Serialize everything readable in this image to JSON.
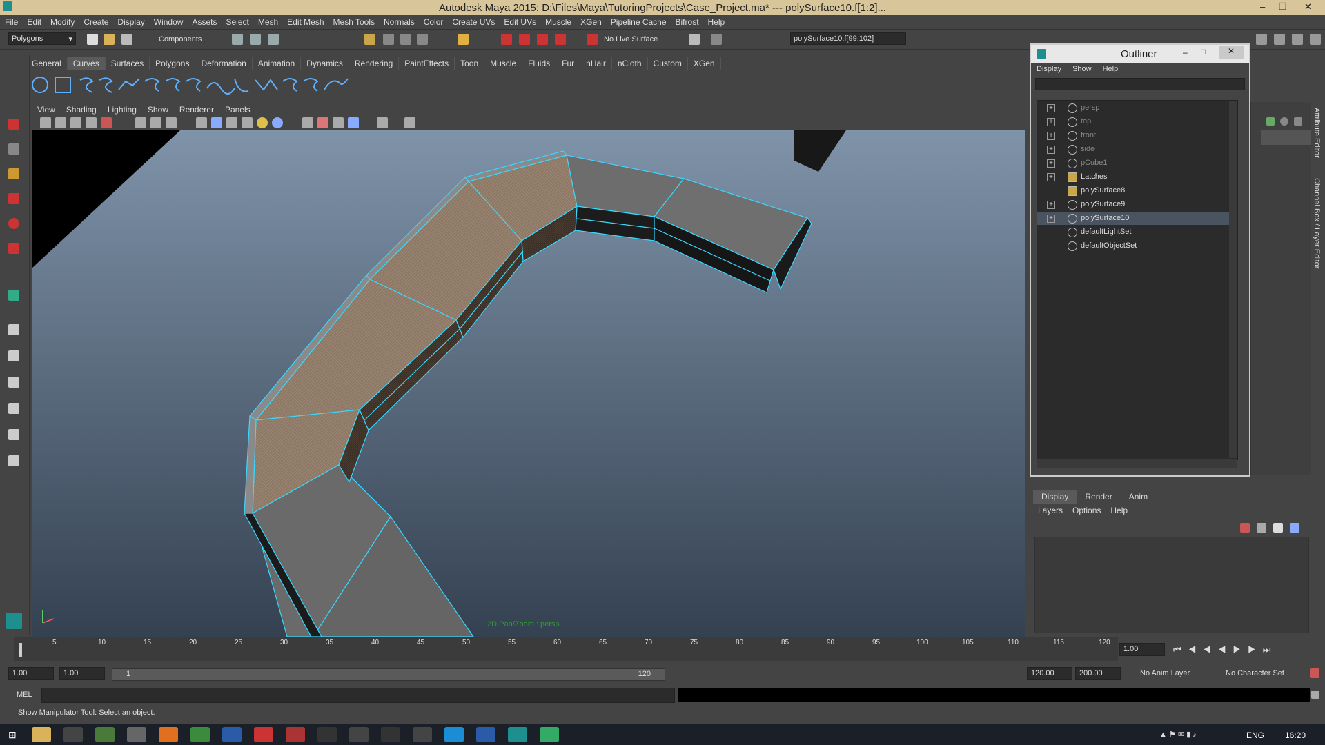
{
  "window": {
    "title": "Autodesk Maya 2015: D:\\Files\\Maya\\TutoringProjects\\Case_Project.ma*  ---  polySurface10.f[1:2]..."
  },
  "menubar": [
    "File",
    "Edit",
    "Modify",
    "Create",
    "Display",
    "Window",
    "Assets",
    "Select",
    "Mesh",
    "Edit Mesh",
    "Mesh Tools",
    "Normals",
    "Color",
    "Create UVs",
    "Edit UVs",
    "Muscle",
    "XGen",
    "Pipeline Cache",
    "Bifrost",
    "Help"
  ],
  "statusline": {
    "menu_set": "Polygons",
    "select_mode": "Components",
    "live_surface": "No Live Surface",
    "selection_field": "polySurface10.f[99:102]"
  },
  "shelf_tabs": [
    "General",
    "Curves",
    "Surfaces",
    "Polygons",
    "Deformation",
    "Animation",
    "Dynamics",
    "Rendering",
    "PaintEffects",
    "Toon",
    "Muscle",
    "Fluids",
    "Fur",
    "nHair",
    "nCloth",
    "Custom",
    "XGen"
  ],
  "shelf_active": "Curves",
  "viewport": {
    "menus": [
      "View",
      "Shading",
      "Lighting",
      "Show",
      "Renderer",
      "Panels"
    ],
    "hud": "2D Pan/Zoom : persp"
  },
  "outliner": {
    "title": "Outliner",
    "menus": [
      "Display",
      "Show",
      "Help"
    ],
    "items": [
      {
        "label": "persp",
        "dim": true,
        "expand": true
      },
      {
        "label": "top",
        "dim": true,
        "expand": true
      },
      {
        "label": "front",
        "dim": true,
        "expand": true
      },
      {
        "label": "side",
        "dim": true,
        "expand": true
      },
      {
        "label": "pCube1",
        "dim": true,
        "expand": true
      },
      {
        "label": "Latches",
        "dim": false,
        "expand": true
      },
      {
        "label": "polySurface8",
        "dim": false,
        "expand": false
      },
      {
        "label": "polySurface9",
        "dim": false,
        "expand": true
      },
      {
        "label": "polySurface10",
        "dim": false,
        "expand": true,
        "selected": true
      },
      {
        "label": "defaultLightSet",
        "dim": false,
        "expand": false
      },
      {
        "label": "defaultObjectSet",
        "dim": false,
        "expand": false
      }
    ]
  },
  "side_tabs": {
    "attr": "Attribute Editor",
    "channel": "Channel Box / Layer Editor"
  },
  "layer_editor": {
    "tabs": [
      "Display",
      "Render",
      "Anim"
    ],
    "menus": [
      "Layers",
      "Options",
      "Help"
    ]
  },
  "timeline": {
    "ticks": [
      "1",
      "5",
      "10",
      "15",
      "20",
      "25",
      "30",
      "35",
      "40",
      "45",
      "50",
      "55",
      "60",
      "65",
      "70",
      "75",
      "80",
      "85",
      "90",
      "95",
      "100",
      "105",
      "110",
      "115",
      "120"
    ],
    "current": "1.00"
  },
  "range": {
    "start": "1.00",
    "start2": "1.00",
    "slider_left": "1",
    "slider_right": "120",
    "end": "120.00",
    "end2": "200.00",
    "anim_layer": "No Anim Layer",
    "char_set": "No Character Set"
  },
  "mel": {
    "label": "MEL"
  },
  "help_line": "Show Manipulator Tool: Select an object.",
  "taskbar": {
    "lang": "ENG",
    "time": "16:20"
  }
}
